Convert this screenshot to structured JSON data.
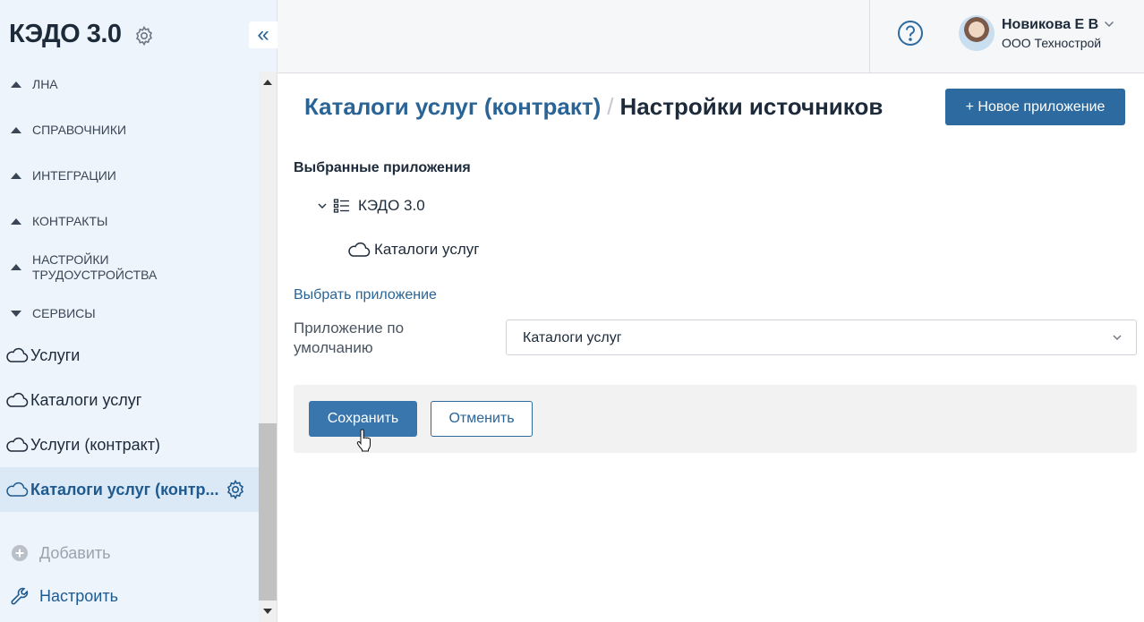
{
  "sidebar": {
    "app_title": "КЭДО 3.0",
    "groups": [
      {
        "label": "ЛНА",
        "state": "collapsed"
      },
      {
        "label": "СПРАВОЧНИКИ",
        "state": "collapsed"
      },
      {
        "label": "ИНТЕГРАЦИИ",
        "state": "collapsed"
      },
      {
        "label": "КОНТРАКТЫ",
        "state": "collapsed"
      },
      {
        "label": "НАСТРОЙКИ ТРУДОУСТРОЙСТВА",
        "state": "collapsed"
      },
      {
        "label": "СЕРВИСЫ",
        "state": "expanded"
      }
    ],
    "items": [
      {
        "label": "Услуги"
      },
      {
        "label": "Каталоги услуг"
      },
      {
        "label": "Услуги (контракт)"
      },
      {
        "label": "Каталоги услуг (контр...",
        "active": true
      }
    ],
    "add_label": "Добавить",
    "setup_label": "Настроить"
  },
  "header": {
    "user_name": "Новикова Е В",
    "user_org": "ООО Технострой"
  },
  "main": {
    "breadcrumb_parent": "Каталоги услуг (контракт)",
    "breadcrumb_separator": "/",
    "breadcrumb_current": "Настройки источников",
    "new_app_button": "+ Новое приложение",
    "selected_apps_title": "Выбранные приложения",
    "tree_root": "КЭДО 3.0",
    "tree_child": "Каталоги услуг",
    "choose_app_link": "Выбрать приложение",
    "default_app_label": "Приложение по умолчанию",
    "default_app_value": "Каталоги услуг",
    "save_button": "Сохранить",
    "cancel_button": "Отменить"
  },
  "colors": {
    "accent": "#2d6a9f",
    "sidebar_bg": "#eef4fb",
    "active_item_bg": "#dbe8f6"
  }
}
